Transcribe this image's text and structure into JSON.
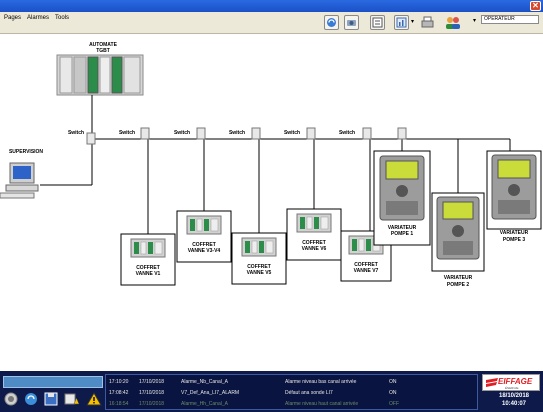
{
  "window": {
    "close_glyph": "✕"
  },
  "menu": [
    "Pages",
    "Alarmes",
    "Tools"
  ],
  "toolbar": {
    "icons": [
      "sync-icon",
      "camera-icon",
      "notepad-icon",
      "report-icon",
      "printer-icon",
      "users-icon"
    ],
    "operator": "OPERATEUR"
  },
  "diagram": {
    "plc_label": [
      "AUTOMATE",
      "TGBT"
    ],
    "supervision_label": "SUPERVISION",
    "switch_label": "Switch",
    "coffrets": [
      [
        "COFFRET",
        "VANNE V1"
      ],
      [
        "COFFRET",
        "VANNE V3-V4"
      ],
      [
        "COFFRET",
        "VANNE V5"
      ],
      [
        "COFFRET",
        "VANNE V6"
      ],
      [
        "COFFRET",
        "VANNE V7"
      ]
    ],
    "variateurs": [
      [
        "VARIATEUR",
        "POMPE 1"
      ],
      [
        "VARIATEUR",
        "POMPE 2"
      ],
      [
        "VARIATEUR",
        "POMPE 3"
      ]
    ]
  },
  "alarms": [
    {
      "time": "17:10:20",
      "date": "17/10/2018",
      "tag": "Alarme_Nb_Canal_A",
      "message": "Alarme niveau bas canal arrivée",
      "state": "ON"
    },
    {
      "time": "17:08:42",
      "date": "17/10/2018",
      "tag": "V7_Def_Ana_LI7_ALARM",
      "message": "Défaut ana sonde LI7",
      "state": "ON"
    },
    {
      "time": "16:18:54",
      "date": "17/10/2018",
      "tag": "Alarme_Hh_Canal_A",
      "message": "Alarme niveau haut canal arrivée",
      "state": "OFF"
    }
  ],
  "brand": {
    "name": "EIFFAGE",
    "sub": "ÉNERGIE"
  },
  "clock": {
    "date": "18/10/2018",
    "time": "10:40:07"
  },
  "colors": {
    "titlebar": "#1a50c8",
    "bottom_bar": "#0d1a4a",
    "brand_red": "#e01e24"
  }
}
